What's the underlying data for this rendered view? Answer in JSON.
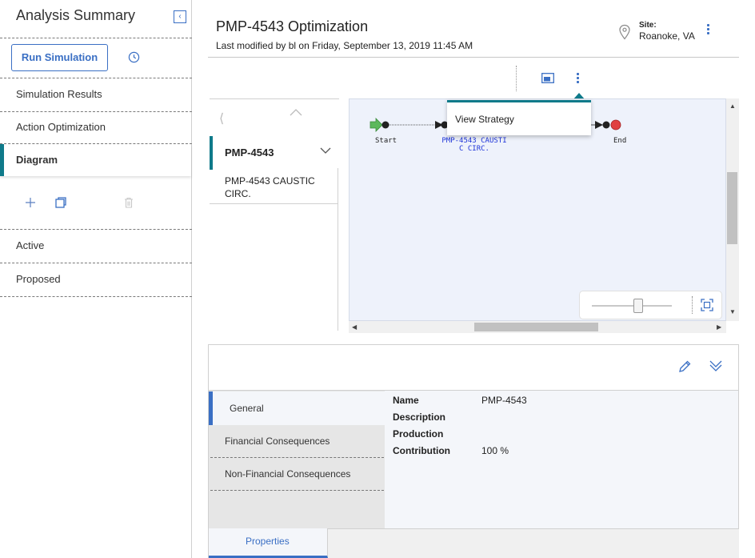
{
  "sidebar": {
    "title": "Analysis Summary",
    "run_button": "Run Simulation",
    "items": [
      {
        "label": "Simulation Results"
      },
      {
        "label": "Action Optimization"
      },
      {
        "label": "Diagram"
      },
      {
        "label": "Active"
      },
      {
        "label": "Proposed"
      }
    ]
  },
  "header": {
    "title": "PMP-4543 Optimization",
    "subtitle": "Last modified by bl on Friday, September 13, 2019 11:45 AM",
    "site_label": "Site:",
    "site_value": "Roanoke, VA"
  },
  "strategy_list": {
    "selected": "PMP-4543",
    "item": "PMP-4543 CAUSTIC CIRC."
  },
  "diagram": {
    "start_label": "Start",
    "action_label": "PMP-4543 CAUSTI\nC CIRC.",
    "end_label": "End"
  },
  "popup": {
    "item": "View Strategy"
  },
  "details": {
    "tabs": [
      {
        "label": "General"
      },
      {
        "label": "Financial Consequences"
      },
      {
        "label": "Non-Financial Consequences"
      }
    ],
    "properties": [
      {
        "key": "Name",
        "value": "PMP-4543"
      },
      {
        "key": "Description",
        "value": ""
      },
      {
        "key": "Production",
        "value": ""
      },
      {
        "key": "Contribution",
        "value": "100 %"
      }
    ],
    "bottom_tab": "Properties"
  },
  "colors": {
    "accent_blue": "#3a6fc4",
    "teal": "#0f7a8a",
    "start_green": "#5cb85c",
    "end_red": "#e04040"
  }
}
